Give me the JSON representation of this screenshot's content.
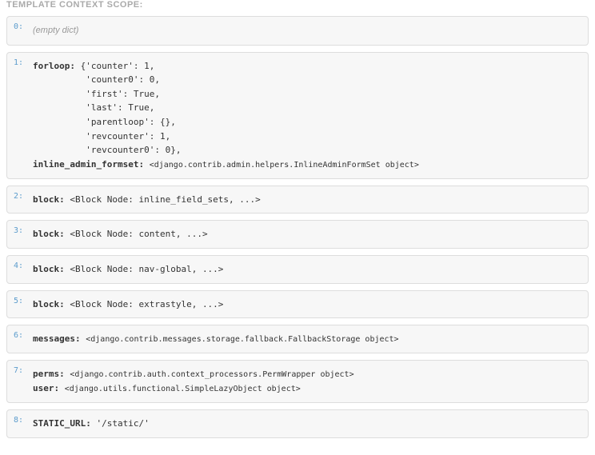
{
  "title": "TEMPLATE CONTEXT SCOPE:",
  "scopes": {
    "s0": {
      "idx": "0:",
      "empty": "(empty dict)"
    },
    "s1": {
      "idx": "1:",
      "forloop_key": "forloop:",
      "forloop_lines": [
        "{'counter': 1,",
        " 'counter0': 0,",
        " 'first': True,",
        " 'last': True,",
        " 'parentloop': {},",
        " 'revcounter': 1,",
        " 'revcounter0': 0},"
      ],
      "inline_key": "inline_admin_formset:",
      "inline_val": "<django.contrib.admin.helpers.InlineAdminFormSet object>"
    },
    "s2": {
      "idx": "2:",
      "key": "block:",
      "val": "<Block Node: inline_field_sets, ...>"
    },
    "s3": {
      "idx": "3:",
      "key": "block:",
      "val": "<Block Node: content, ...>"
    },
    "s4": {
      "idx": "4:",
      "key": "block:",
      "val": "<Block Node: nav-global, ...>"
    },
    "s5": {
      "idx": "5:",
      "key": "block:",
      "val": "<Block Node: extrastyle, ...>"
    },
    "s6": {
      "idx": "6:",
      "key": "messages:",
      "val": "<django.contrib.messages.storage.fallback.FallbackStorage object>"
    },
    "s7": {
      "idx": "7:",
      "key1": "perms:",
      "val1": "<django.contrib.auth.context_processors.PermWrapper object>",
      "key2": "user:",
      "val2": "<django.utils.functional.SimpleLazyObject object>"
    },
    "s8": {
      "idx": "8:",
      "key": "STATIC_URL:",
      "val": "'/static/'"
    }
  }
}
